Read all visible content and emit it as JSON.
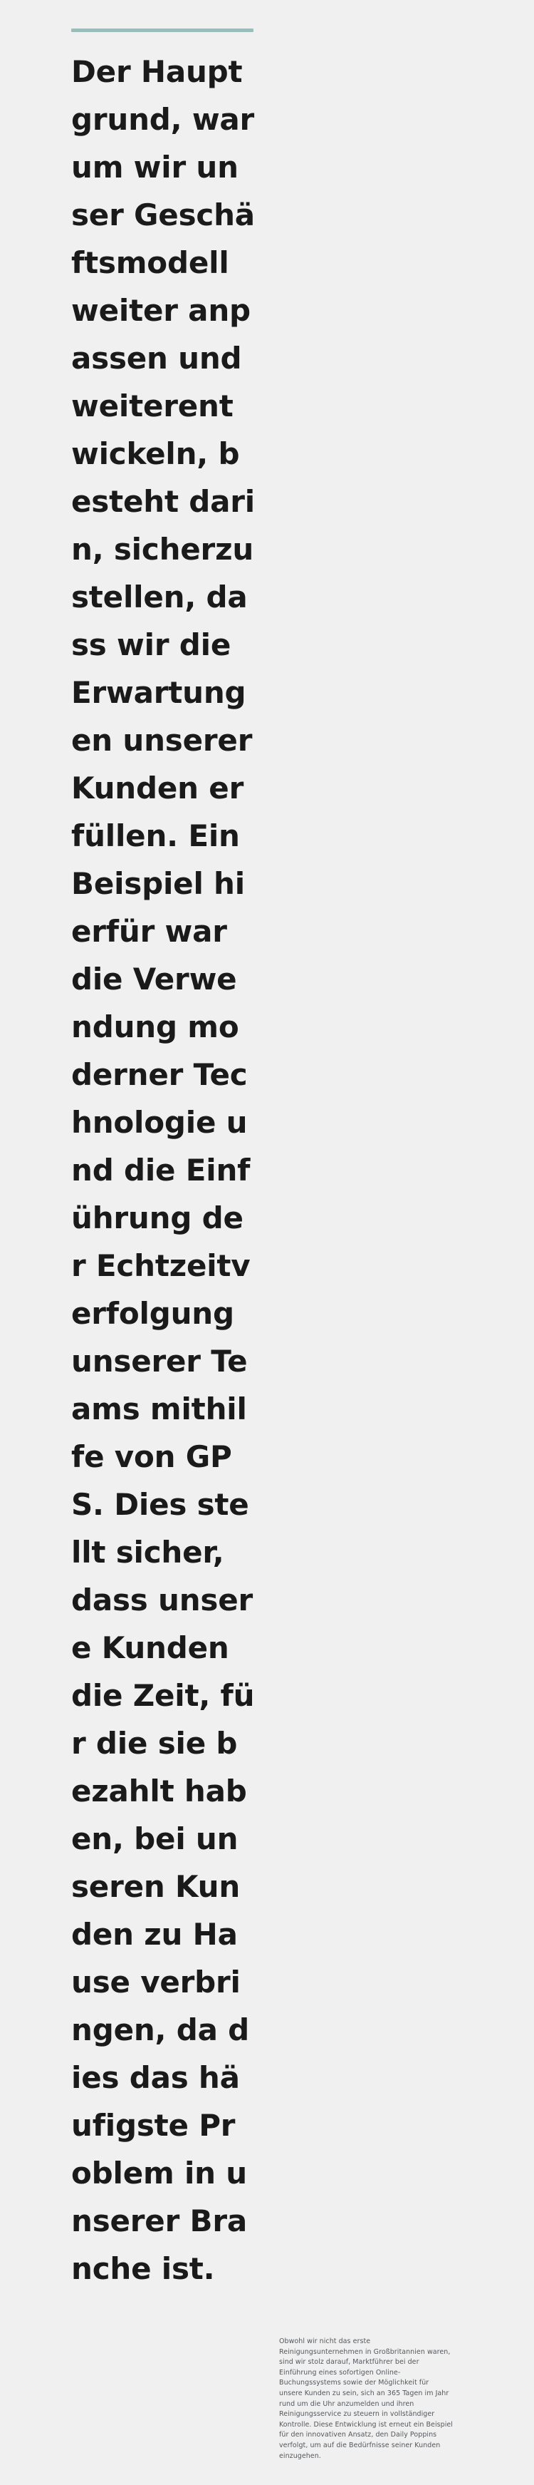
{
  "theme": {
    "background_color": "#f0f0f0",
    "accent_color": "#9cbcba",
    "quote_text_color": "#1a1a1a",
    "body_text_color": "#54585c"
  },
  "quote_block": {
    "divider": "accent-rule",
    "text": "Der Hauptgrund, warum wir unser Geschäftsmodell weiter anpassen und weiterentwickeln, besteht darin, sicherzustellen, dass wir die Erwartungen unserer Kunden erfüllen. Ein Beispiel hierfür war die Verwendung moderner Technologie und die Einführung der Echtzeitverfolgung unserer Teams mithilfe von GPS. Dies stellt sicher, dass unsere Kunden die Zeit, für die sie bezahlt haben, bei unseren Kunden zu Hause verbringen, da dies das häufigste Problem in unserer Branche ist."
  },
  "body_block": {
    "text": "Obwohl wir nicht das erste Reinigungsunternehmen in Großbritannien waren, sind wir stolz darauf, Marktführer bei der Einführung eines sofortigen Online-Buchungssystems sowie der Möglichkeit für unsere Kunden zu sein, sich an 365 Tagen im Jahr rund um die Uhr anzumelden und ihren Reinigungsservice zu steuern in vollständiger Kontrolle. Diese Entwicklung ist erneut ein Beispiel für den innovativen Ansatz, den Daily Poppins verfolgt, um auf die Bedürfnisse seiner Kunden einzugehen."
  }
}
